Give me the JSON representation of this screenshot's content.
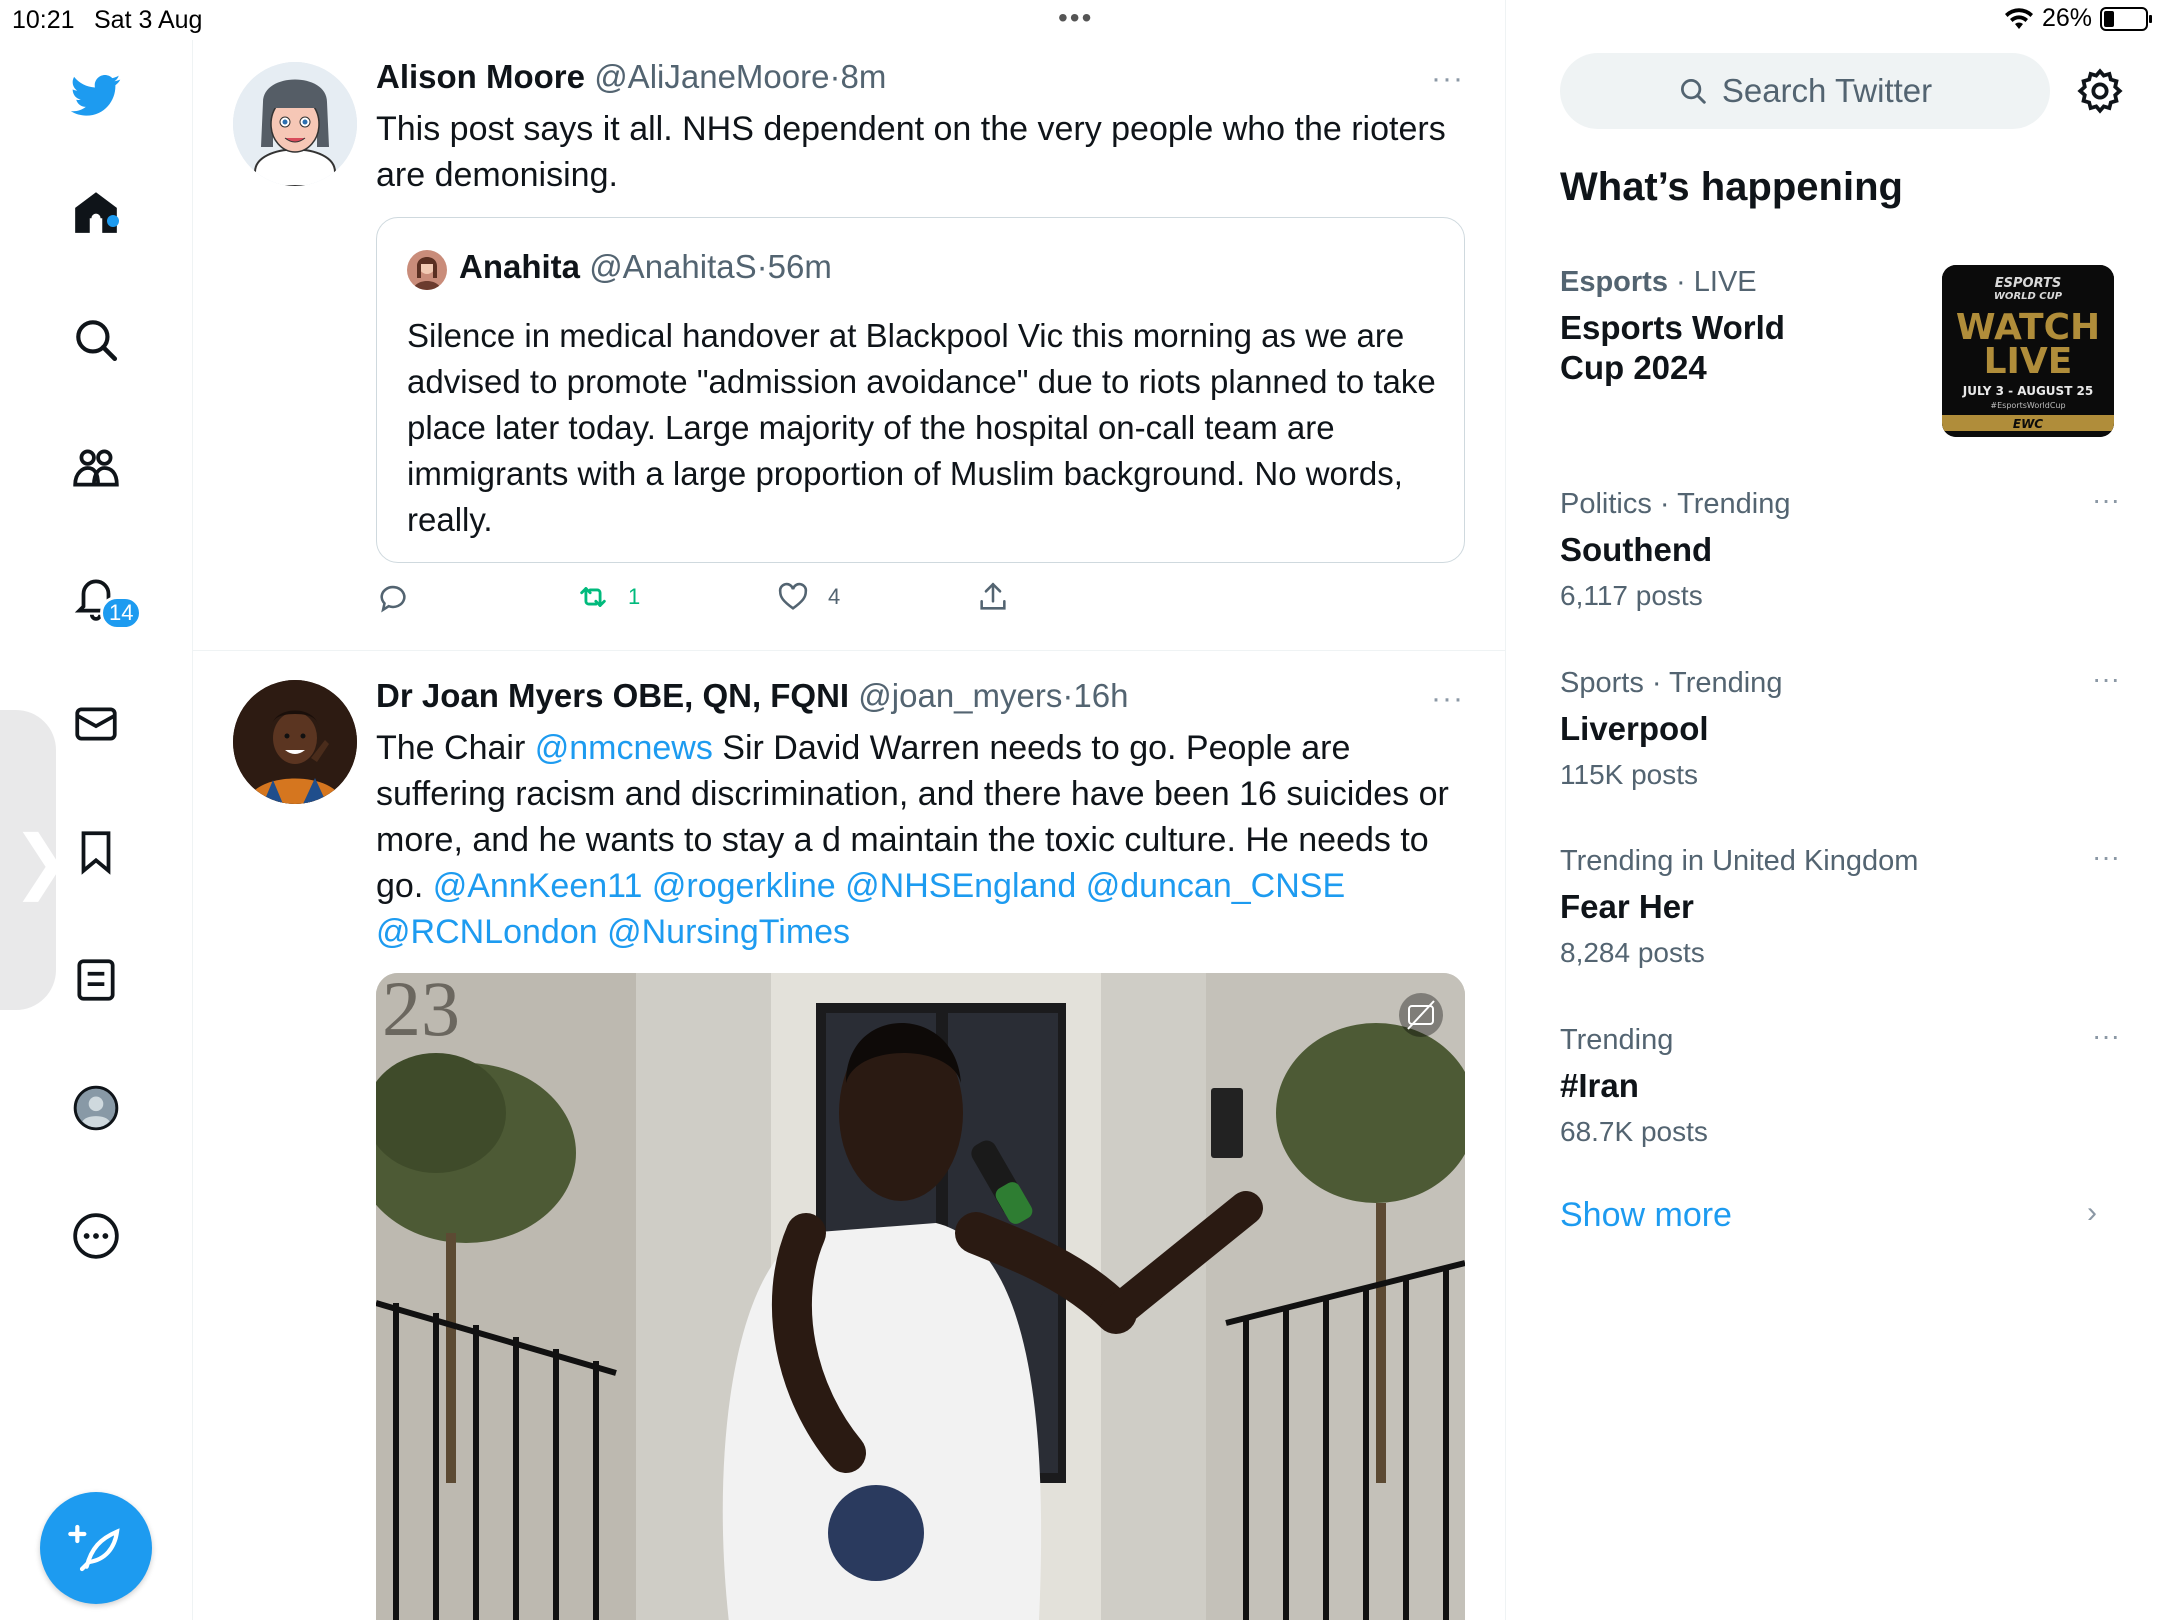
{
  "status_bar": {
    "time": "10:21",
    "date": "Sat 3 Aug",
    "battery": "26%",
    "battery_level_fraction": 0.26
  },
  "nav": {
    "items": [
      {
        "icon": "twitter-bird-icon"
      },
      {
        "icon": "home-icon"
      },
      {
        "icon": "search-icon"
      },
      {
        "icon": "communities-icon"
      },
      {
        "icon": "notifications-bell-icon"
      },
      {
        "icon": "messages-envelope-icon"
      },
      {
        "icon": "bookmark-icon"
      },
      {
        "icon": "lists-icon"
      },
      {
        "icon": "profile-avatar-icon"
      },
      {
        "icon": "more-ellipsis-icon"
      }
    ],
    "notification_count": "14",
    "compose_icon": "compose-feather-icon"
  },
  "timeline": {
    "tweets": [
      {
        "name": "Alison Moore",
        "handle": "@AliJaneMoore",
        "sep": "·",
        "ago": "8m",
        "text": "This post says it all. NHS dependent on the very people who the rioters are demonising.",
        "quote": {
          "name": "Anahita",
          "handle": "@AnahitaS",
          "sep": "·",
          "ago": "56m",
          "text": "Silence in medical handover at Blackpool Vic this morning as we are advised to promote \"admission avoidance\" due to riots planned to take place later today. Large majority of the hospital on-call team are immigrants with a large proportion of Muslim background. No words, really."
        },
        "actions": {
          "reply": "",
          "retweet": "1",
          "like": "4"
        }
      },
      {
        "name": "Dr Joan Myers OBE, QN, FQNI",
        "handle": "@joan_myers",
        "sep": "·",
        "ago": "16h",
        "text_parts": {
          "t1": "The Chair ",
          "m1": "@nmcnews",
          "t2": " Sir David Warren needs to go. People are suffering racism and discrimination, and there have been 16 suicides or more, and he wants to stay a d maintain the toxic culture. He needs to go. ",
          "m2": "@AnnKeen11",
          "m3": "@rogerkline",
          "m4": "@NHSEngland",
          "m5": "@duncan_CNSE",
          "m6": "@RCNLondon",
          "m7": "@NursingTimes"
        },
        "media_text": "23"
      }
    ]
  },
  "sidebar": {
    "search_placeholder": "Search Twitter",
    "heading": "What’s happening",
    "trends": [
      {
        "category": "Esports",
        "sep": " · ",
        "tag": "LIVE",
        "title_line1": "Esports World",
        "title_line2": "Cup 2024",
        "posts": ""
      },
      {
        "category": "Politics · Trending",
        "title": "Southend",
        "posts": "6,117 posts"
      },
      {
        "category": "Sports · Trending",
        "title": "Liverpool",
        "posts": "115K posts"
      },
      {
        "category": "Trending in United Kingdom",
        "title": "Fear Her",
        "posts": "8,284 posts"
      },
      {
        "category": "Trending",
        "title": "#Iran",
        "posts": "68.7K posts"
      }
    ],
    "esports_thumb": {
      "line1": "ESPORTS",
      "line2": "WORLD CUP",
      "watch": "WATCH",
      "live": "LIVE",
      "dates": "JULY 3 - AUGUST 25",
      "hashtag": "#EsportsWorldCup",
      "strip": "EWC"
    },
    "show_more": "Show more",
    "more_dots": "···"
  },
  "colors": {
    "accent": "#1d9bf0",
    "retweet_green": "#00ba7c",
    "secondary_text": "#536471"
  }
}
